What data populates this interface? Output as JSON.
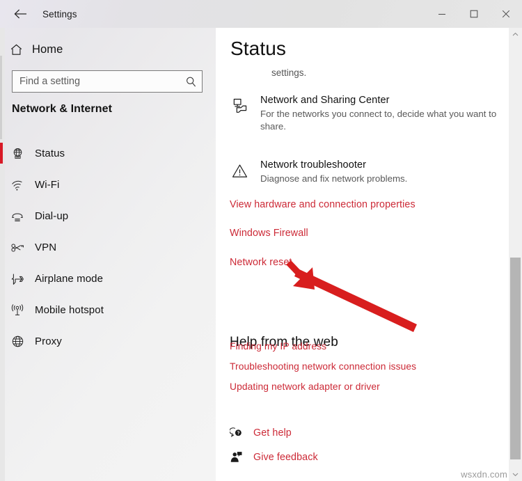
{
  "window": {
    "title": "Settings",
    "back_icon": "back-arrow-icon",
    "controls": {
      "minimize": "minimize-icon",
      "maximize": "maximize-icon",
      "close": "close-icon"
    }
  },
  "sidebar": {
    "home": {
      "label": "Home",
      "icon": "home-icon"
    },
    "search": {
      "placeholder": "Find a setting",
      "value": "",
      "icon": "search-icon"
    },
    "category": "Network & Internet",
    "items": [
      {
        "label": "Status",
        "icon": "network-status-icon",
        "selected": true
      },
      {
        "label": "Wi-Fi",
        "icon": "wifi-icon",
        "selected": false
      },
      {
        "label": "Dial-up",
        "icon": "dialup-phone-icon",
        "selected": false
      },
      {
        "label": "VPN",
        "icon": "vpn-key-icon",
        "selected": false
      },
      {
        "label": "Airplane mode",
        "icon": "airplane-icon",
        "selected": false
      },
      {
        "label": "Mobile hotspot",
        "icon": "hotspot-icon",
        "selected": false
      },
      {
        "label": "Proxy",
        "icon": "globe-icon",
        "selected": false
      }
    ],
    "accent_color": "#d81a27"
  },
  "main": {
    "page_title": "Status",
    "intro_tail": "settings.",
    "settings": [
      {
        "title": "Network and Sharing Center",
        "desc": "For the networks you connect to, decide what you want to share.",
        "icon": "network-sharing-icon"
      },
      {
        "title": "Network troubleshooter",
        "desc": "Diagnose and fix network problems.",
        "icon": "warning-triangle-icon"
      }
    ],
    "links": [
      "View hardware and connection properties",
      "Windows Firewall",
      "Network reset"
    ],
    "help_heading": "Help from the web",
    "web_links": [
      "Finding my IP address",
      "Troubleshooting network connection issues",
      "Updating network adapter or driver"
    ],
    "footer_links": [
      {
        "label": "Get help",
        "icon": "question-bubble-icon"
      },
      {
        "label": "Give feedback",
        "icon": "feedback-person-icon"
      }
    ],
    "link_color": "#cc2936"
  },
  "scrollbar": {
    "up_icon": "chevron-up-icon",
    "down_icon": "chevron-down-icon"
  },
  "annotation": {
    "type": "red-arrow",
    "color": "#d81e1e",
    "points_to": "Network reset"
  },
  "watermark": "wsxdn.com"
}
